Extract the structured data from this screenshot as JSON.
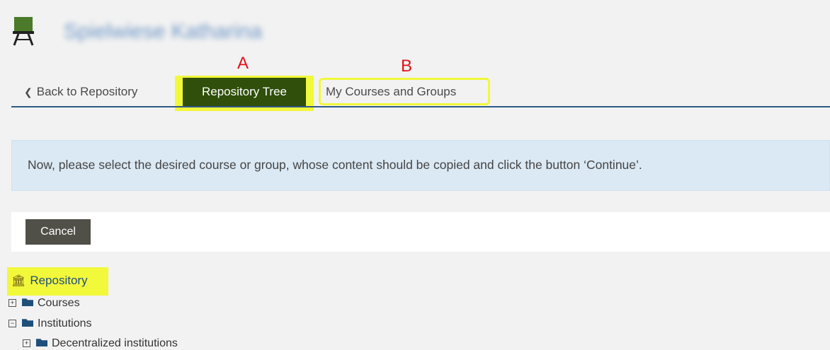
{
  "header": {
    "course_title": "Spielwiese Katharina"
  },
  "tabs": {
    "back_label": "Back to Repository",
    "active_label": "Repository Tree",
    "second_label": "My Courses and Groups"
  },
  "annotations": {
    "marker_a": "A",
    "marker_b": "B"
  },
  "info": {
    "message": "Now, please select the desired course or group, whose content should be copied and click the button ‘Continue’."
  },
  "toolbar": {
    "cancel_label": "Cancel"
  },
  "tree": {
    "root_label": "Repository",
    "items": [
      {
        "label": "Courses",
        "state": "collapsed"
      },
      {
        "label": "Institutions",
        "state": "expanded"
      },
      {
        "label": "Decentralized institutions",
        "state": "collapsed"
      }
    ]
  },
  "colors": {
    "active_tab": "#2f4f0a",
    "highlight": "#f2f83a",
    "marker": "#e0111b",
    "info_bg": "#dbe9f4",
    "link": "#1f4f7b"
  }
}
